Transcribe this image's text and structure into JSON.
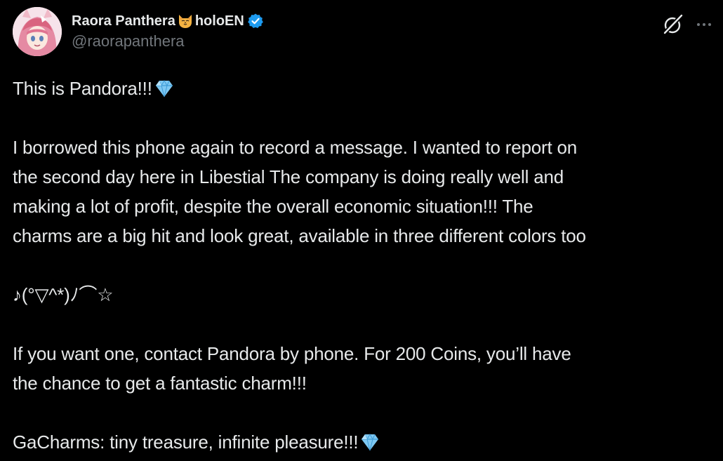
{
  "author": {
    "display_name_part1": "Raora Panthera",
    "display_name_part2": "holoEN",
    "handle": "@raorapanthera",
    "emoji_icon": "cat-face-icon",
    "verified_icon": "verified-badge-icon"
  },
  "actions": {
    "grok_icon": "grok-icon",
    "more_icon": "more-options-icon"
  },
  "tweet": {
    "line1": "This is Pandora!!!",
    "line2": "I borrowed this phone again to record a message. I wanted to report on",
    "line3": "the second day here in Libestial The company is doing really well and",
    "line4": "making a lot of profit, despite the overall economic situation!!! The",
    "line5": "charms are a big hit and look great, available in three different colors too",
    "line6": "♪(๑ᴖ◡ᴖ๑)♪",
    "line6_render": "♪(°▽^*)ﾉ⌒☆",
    "line7": "If you want one, contact Pandora by phone. For 200 Coins, you’ll have",
    "line8": "the chance to get a fantastic charm!!!",
    "line9": "GaCharms: tiny treasure, infinite pleasure!!!",
    "gem_icon": "gem-stone-icon"
  },
  "colors": {
    "background": "#000000",
    "text": "#e7e9ea",
    "secondary_text": "#71767b",
    "verified": "#1d9bf0"
  }
}
